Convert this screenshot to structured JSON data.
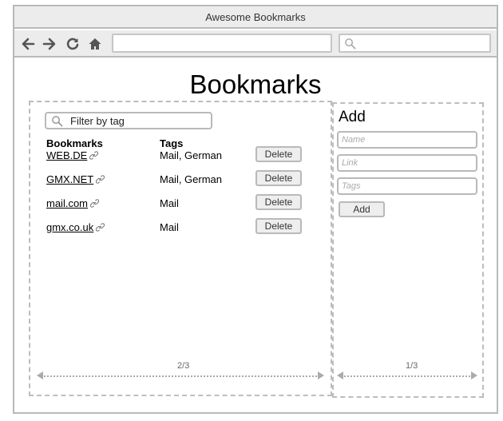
{
  "window": {
    "title": "Awesome Bookmarks"
  },
  "toolbar": {
    "nav": [
      "back-arrow-icon",
      "forward-arrow-icon",
      "reload-icon",
      "home-icon"
    ],
    "url_value": "",
    "search_value": ""
  },
  "page": {
    "title": "Bookmarks"
  },
  "filter": {
    "placeholder": "Filter by tag"
  },
  "table": {
    "headers": {
      "bookmarks": "Bookmarks",
      "tags": "Tags"
    },
    "rows": [
      {
        "name": "WEB.DE",
        "tags": "Mail, German",
        "action": "Delete"
      },
      {
        "name": "GMX.NET",
        "tags": "Mail, German",
        "action": "Delete"
      },
      {
        "name": "mail.com",
        "tags": "Mail",
        "action": "Delete"
      },
      {
        "name": "gmx.co.uk",
        "tags": "Mail",
        "action": "Delete"
      }
    ]
  },
  "add_form": {
    "title": "Add",
    "name_placeholder": "Name",
    "link_placeholder": "Link",
    "tags_placeholder": "Tags",
    "submit_label": "Add"
  },
  "layout_labels": {
    "left_width": "2/3",
    "right_width": "1/3"
  },
  "colors": {
    "border": "#b9b9b9",
    "chrome": "#ececec",
    "dashed": "#bdbdbd"
  }
}
